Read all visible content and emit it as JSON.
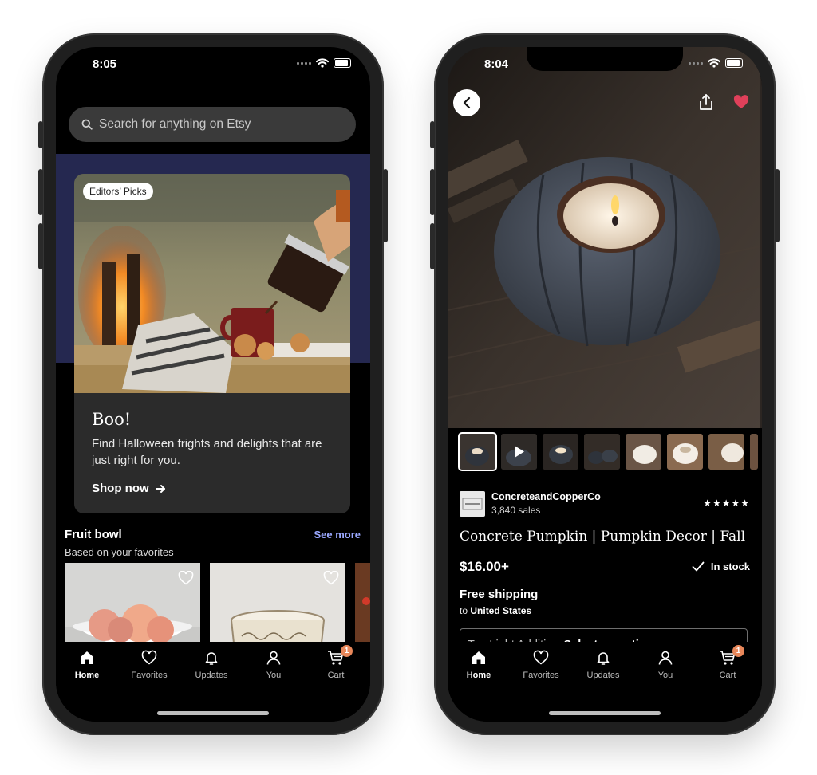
{
  "phones": {
    "left": {
      "status_time": "8:05",
      "search_placeholder": "Search for anything on Etsy",
      "promo": {
        "badge": "Editors’ Picks",
        "title": "Boo!",
        "body": "Find Halloween frights and delights that are just right for you.",
        "cta": "Shop now"
      },
      "section": {
        "title": "Fruit bowl",
        "subtitle": "Based on your favorites",
        "see_more": "See more"
      }
    },
    "right": {
      "status_time": "8:04",
      "shop": {
        "name": "ConcreteandCopperCo",
        "sales": "3,840 sales",
        "rating_stars": "★★★★★"
      },
      "product": {
        "title": "Concrete Pumpkin | Pumpkin Decor | Fall De...",
        "price": "$16.00+",
        "stock": "In stock",
        "shipping": "Free shipping",
        "shipping_to_prefix": "to",
        "shipping_to": "United States",
        "option_label": "Tea Light Addition",
        "option_value": "Select an option"
      }
    }
  },
  "tabbar": {
    "home": "Home",
    "favorites": "Favorites",
    "updates": "Updates",
    "you": "You",
    "cart": "Cart",
    "cart_count": "1"
  },
  "colors": {
    "accent_link": "#9aa8ff",
    "favorite_heart": "#e0405a",
    "cart_badge": "#e8875a",
    "promo_band": "#252850"
  },
  "icons": [
    "search-icon",
    "arrow-right-icon",
    "heart-icon",
    "home-icon",
    "bell-icon",
    "user-icon",
    "cart-icon",
    "back-arrow-icon",
    "share-icon",
    "play-icon",
    "checkmark-icon",
    "chevron-down-icon",
    "wifi-icon",
    "battery-icon"
  ]
}
